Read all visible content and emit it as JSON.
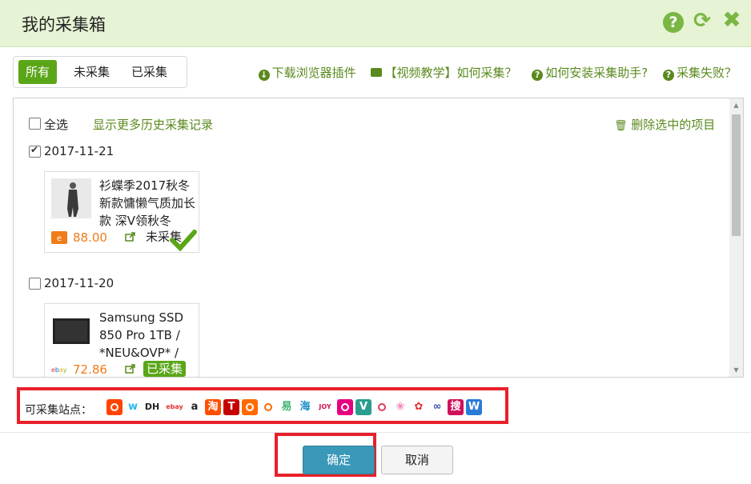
{
  "dialog": {
    "title": "我的采集箱"
  },
  "tabs": [
    {
      "label": "所有",
      "active": true
    },
    {
      "label": "未采集",
      "active": false
    },
    {
      "label": "已采集",
      "active": false
    }
  ],
  "links": {
    "download_plugin": "下载浏览器插件",
    "video_tutorial": "【视频教学】如何采集？",
    "install_helper": "如何安装采集助手?",
    "collect_failed": "采集失败？"
  },
  "list": {
    "select_all": "全选",
    "show_more_history": "显示更多历史采集记录",
    "delete_selected": "删除选中的项目",
    "groups": [
      {
        "date": "2017-11-21",
        "checked": true,
        "item": {
          "title": "衫蝶季2017秋冬新款慵懒气质加长款 深V领秋冬",
          "price": "88.00",
          "site_icon": "alibaba-icon",
          "status": "未采集"
        }
      },
      {
        "date": "2017-11-20",
        "checked": false,
        "item": {
          "title": "Samsung SSD 850 Pro 1TB / *NEU&OVP* /",
          "price": "72.86",
          "site_icon": "ebay-icon",
          "status": "已采集"
        }
      }
    ]
  },
  "sites": {
    "label": "可采集站点：",
    "icons": [
      "taobao",
      "wish",
      "dhgate",
      "ebay",
      "amazon",
      "tao",
      "tmall",
      "alibaba",
      "aliexpress",
      "yi",
      "hai",
      "joy",
      "kaola",
      "vip",
      "smile",
      "sakura",
      "flower",
      "infinity",
      "sou",
      "w"
    ],
    "glyphs": {
      "wish": "w",
      "dhgate": "DH",
      "ebay": "ebay",
      "amazon": "a",
      "tao": "淘",
      "tmall": "T",
      "yi": "易",
      "hai": "海",
      "joy": "JOY",
      "vip": "V",
      "sou": "搜",
      "w": "W",
      "infinity": "∞",
      "flower": "✿",
      "sakura": "❀"
    }
  },
  "buttons": {
    "ok": "确定",
    "cancel": "取消"
  },
  "colors": {
    "header_bg": "#e6f3d4",
    "accent_green": "#5aa618",
    "link_green": "#5a8a1e",
    "ok_blue": "#3a98b8",
    "highlight_red": "#e8202a",
    "price_orange": "#f07c1a"
  }
}
